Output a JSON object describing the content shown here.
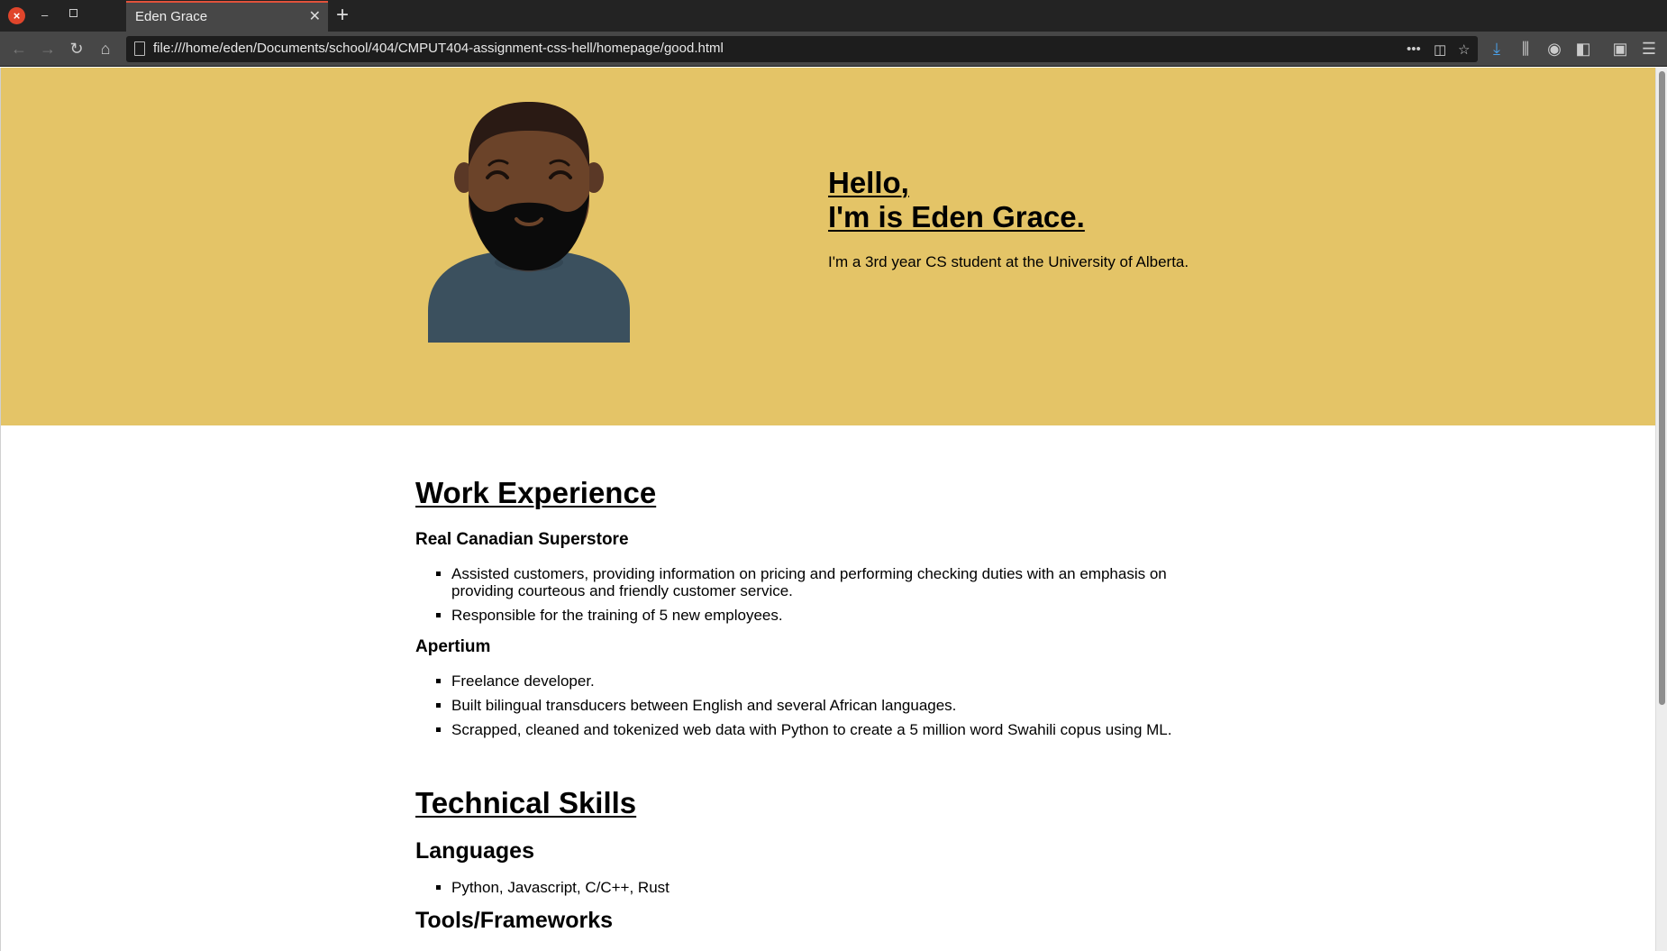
{
  "browser": {
    "tab_title": "Eden Grace",
    "url": "file:///home/eden/Documents/school/404/CMPUT404-assignment-css-hell/homepage/good.html",
    "accent": "#e2523b"
  },
  "hero": {
    "background": "#e4c467",
    "greeting_line1": "Hello,",
    "greeting_line2": "I'm is Eden Grace.",
    "intro": "I'm a 3rd year CS student at the University of Alberta."
  },
  "work": {
    "title": "Work Experience",
    "jobs": [
      {
        "name": "Real Canadian Superstore",
        "items": [
          "Assisted customers, providing information on pricing and performing checking duties with an emphasis on providing courteous and friendly customer service.",
          "Responsible for the training of 5 new employees."
        ]
      },
      {
        "name": "Apertium",
        "items": [
          "Freelance developer.",
          "Built bilingual transducers between English and several African languages.",
          "Scrapped, cleaned and tokenized web data with Python to create a 5 million word Swahili copus using ML."
        ]
      }
    ]
  },
  "skills": {
    "title": "Technical Skills",
    "languages_title": "Languages",
    "languages": "Python, Javascript, C/C++, Rust",
    "tools_title": "Tools/Frameworks"
  }
}
